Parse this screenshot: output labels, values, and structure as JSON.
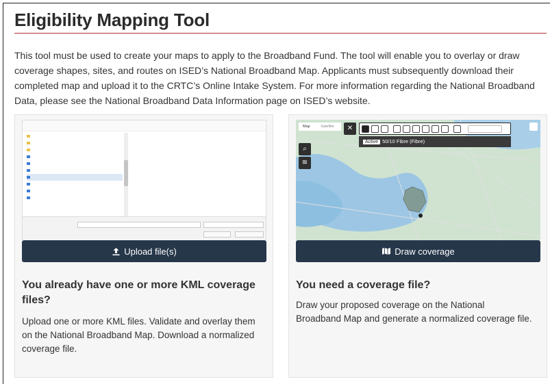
{
  "page": {
    "title": "Eligibility Mapping Tool",
    "intro": "This tool must be used to create your maps to apply to the Broadband Fund. The tool will enable you to overlay or draw coverage shapes, sites, and routes on ISED’s National Broadband Map. Applicants must subsequently download their completed map and upload it to the CRTC’s Online Intake System. For more information regarding the National Broadband Data, please see the National Broadband Data Information page on ISED’s website."
  },
  "upload_card": {
    "button_label": "Upload file(s)",
    "heading": "You already have one or more KML coverage files?",
    "description": "Upload one or more KML files. Validate and overlay them on the National Broadband Map. Download a normalized coverage file.",
    "icon": "upload-icon"
  },
  "draw_card": {
    "button_label": "Draw coverage",
    "heading": "You need a coverage file?",
    "description": "Draw your proposed coverage on the National Broadband Map and generate a normalized coverage file.",
    "icon": "map-icon",
    "map_active_label": "Active",
    "map_active_value": "50/10 Fibre (Fibre)",
    "map_tab_map": "Map",
    "map_tab_satellite": "Satellite"
  },
  "colors": {
    "button_bg": "#26374a",
    "title_rule": "#b03030",
    "card_bg": "#f6f6f6"
  }
}
